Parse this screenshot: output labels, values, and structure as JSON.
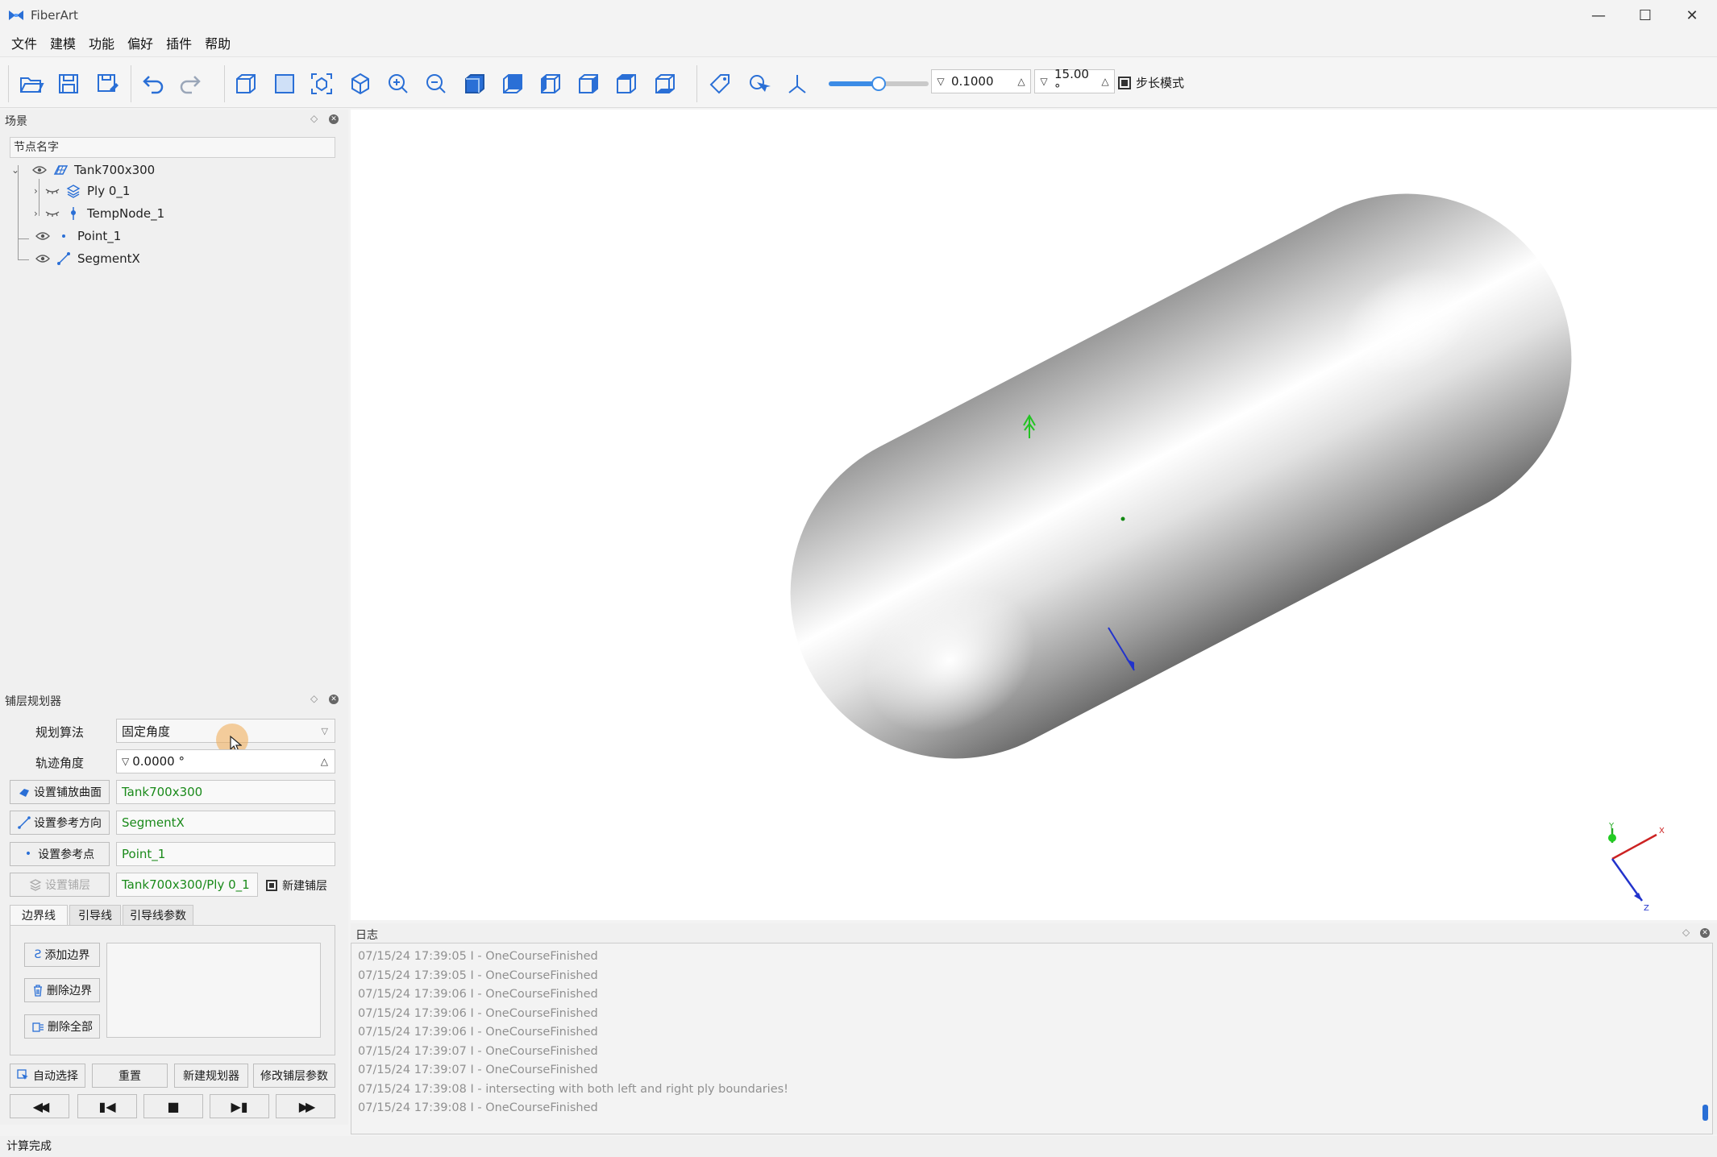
{
  "window": {
    "title": "FiberArt",
    "minimize_glyph": "—",
    "maximize_glyph": "☐",
    "close_glyph": "✕"
  },
  "menu": [
    "文件",
    "建模",
    "功能",
    "偏好",
    "插件",
    "帮助"
  ],
  "toolbar": {
    "icons": [
      "open-folder-icon",
      "save-icon",
      "save-as-icon",
      "undo-icon",
      "redo-icon",
      "view-iso-icon",
      "view-plane-icon",
      "fit-all-icon",
      "view-3d-icon",
      "zoom-in-icon",
      "zoom-out-icon",
      "view-front-icon",
      "view-back-icon",
      "view-left-icon",
      "view-right-icon",
      "view-top-icon",
      "view-bottom-icon",
      "tag-icon",
      "pick-icon",
      "axes-icon"
    ],
    "slider_level": 0.5,
    "step_value": "0.1000",
    "angle_value": "15.00 °",
    "step_mode_label": "步长模式",
    "accent_color": "#3c8ce6"
  },
  "scene": {
    "title": "场景",
    "header": "节点名字",
    "nodes": [
      {
        "label": "Tank700x300",
        "icon": "surface-icon"
      },
      {
        "label": "Ply 0_1",
        "icon": "ply-layers-icon"
      },
      {
        "label": "TempNode_1",
        "icon": "temp-node-icon"
      },
      {
        "label": "Point_1",
        "icon": "point-icon"
      },
      {
        "label": "SegmentX",
        "icon": "segment-icon"
      }
    ]
  },
  "planner": {
    "title": "铺层规划器",
    "algorithm_label": "规划算法",
    "algorithm_value": "固定角度",
    "angle_label": "轨迹角度",
    "angle_value": "0.0000 °",
    "set_surface_label": "设置铺放曲面",
    "surface_value": "Tank700x300",
    "set_direction_label": "设置参考方向",
    "direction_value": "SegmentX",
    "set_point_label": "设置参考点",
    "point_value": "Point_1",
    "set_ply_label": "设置铺层",
    "ply_value": "Tank700x300/Ply 0_1",
    "new_ply_label": "新建铺层",
    "tabs": [
      "边界线",
      "引导线",
      "引导线参数"
    ],
    "add_boundary_label": "添加边界",
    "delete_boundary_label": "删除边界",
    "delete_all_label": "删除全部",
    "auto_select_label": "自动选择",
    "reset_label": "重置",
    "new_planner_label": "新建规划器",
    "modify_params_label": "修改铺层参数",
    "playback": [
      "rewind-icon",
      "step-back-icon",
      "stop-icon",
      "step-forward-icon",
      "fast-forward-icon"
    ]
  },
  "viewport": {
    "axis_labels": {
      "x": "X",
      "y": "Y",
      "z": "Z"
    }
  },
  "log": {
    "title": "日志",
    "lines": [
      "07/15/24 17:39:05 I - OneCourseFinished",
      "07/15/24 17:39:05 I - OneCourseFinished",
      "07/15/24 17:39:06 I - OneCourseFinished",
      "07/15/24 17:39:06 I - OneCourseFinished",
      "07/15/24 17:39:06 I - OneCourseFinished",
      "07/15/24 17:39:07 I - OneCourseFinished",
      "07/15/24 17:39:07 I - OneCourseFinished",
      "07/15/24 17:39:08 I - intersecting with both left and right ply boundaries!",
      "07/15/24 17:39:08 I - OneCourseFinished"
    ]
  },
  "status": {
    "text": "计算完成"
  }
}
